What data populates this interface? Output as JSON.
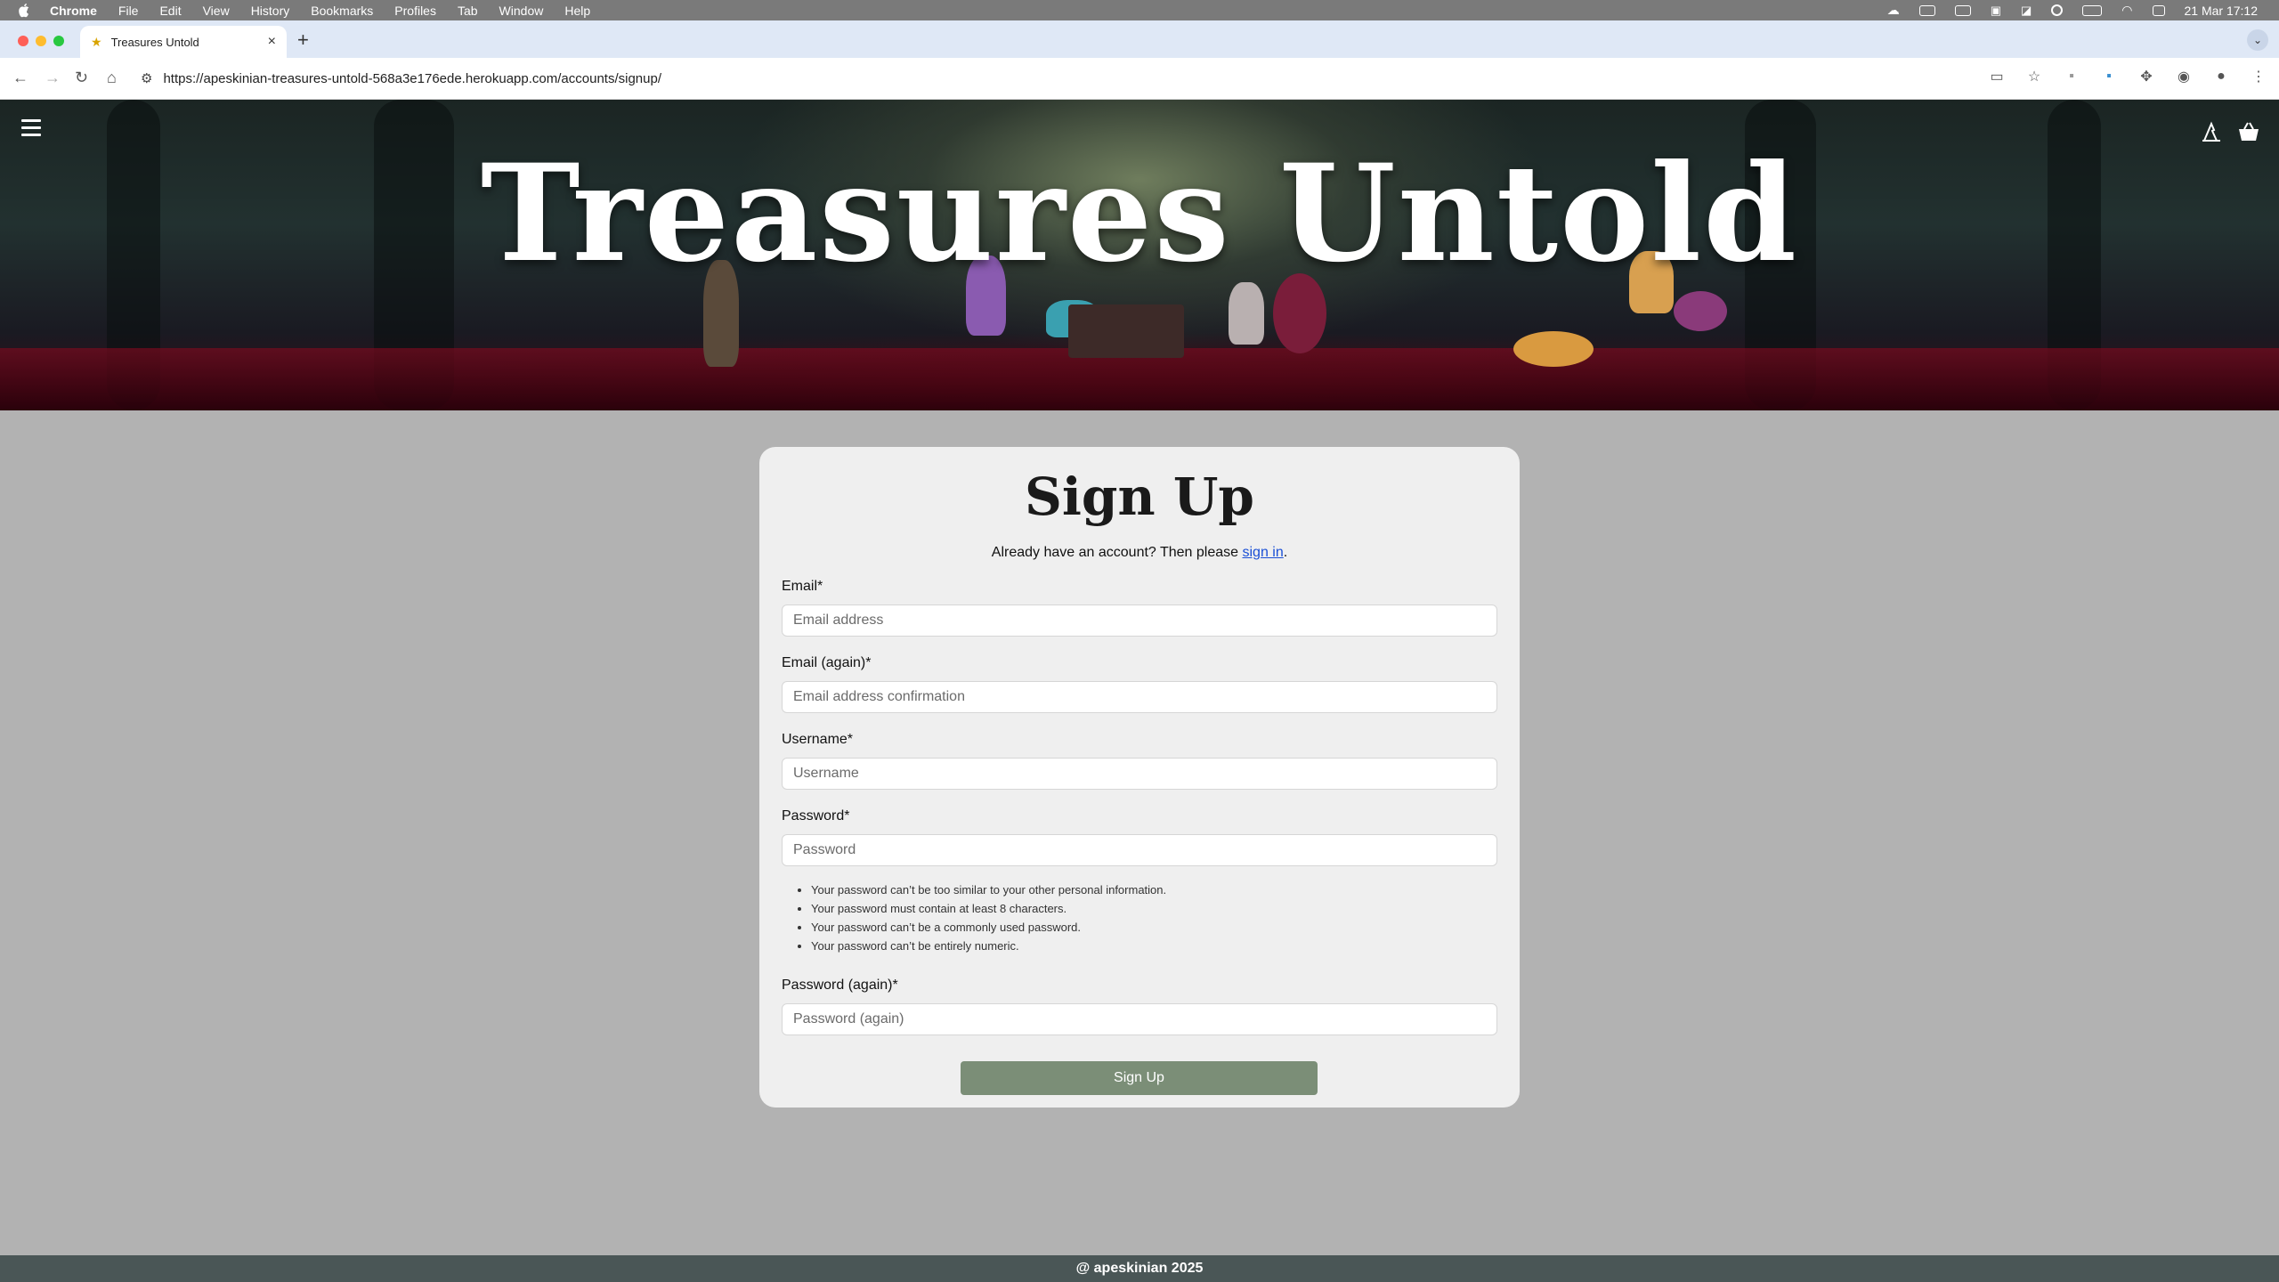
{
  "menubar": {
    "app": "Chrome",
    "items": [
      "File",
      "Edit",
      "View",
      "History",
      "Bookmarks",
      "Profiles",
      "Tab",
      "Window",
      "Help"
    ],
    "clock": "21 Mar  17:12"
  },
  "tab": {
    "title": "Treasures Untold",
    "close_label": "×",
    "new_tab_label": "+"
  },
  "toolbar": {
    "url": "https://apeskinian-treasures-untold-568a3e176ede.herokuapp.com/accounts/signup/"
  },
  "header": {
    "brand": "Treasures Untold"
  },
  "signup": {
    "title": "Sign Up",
    "already_text": "Already have an account? Then please ",
    "signin_link": "sign in",
    "period": ".",
    "email_label": "Email*",
    "email_placeholder": "Email address",
    "email2_label": "Email (again)*",
    "email2_placeholder": "Email address confirmation",
    "username_label": "Username*",
    "username_placeholder": "Username",
    "password_label": "Password*",
    "password_placeholder": "Password",
    "help": [
      "Your password can’t be too similar to your other personal information.",
      "Your password must contain at least 8 characters.",
      "Your password can’t be a commonly used password.",
      "Your password can’t be entirely numeric."
    ],
    "password2_label": "Password (again)*",
    "password2_placeholder": "Password (again)",
    "submit_label": "Sign Up"
  },
  "footer": {
    "text": "@ apeskinian 2025"
  },
  "colors": {
    "page_bg": "#b2b2b2",
    "card_bg": "#efefef",
    "button_bg": "#7b8e77",
    "footer_bg": "#4a5656",
    "link": "#1a4fd6"
  }
}
